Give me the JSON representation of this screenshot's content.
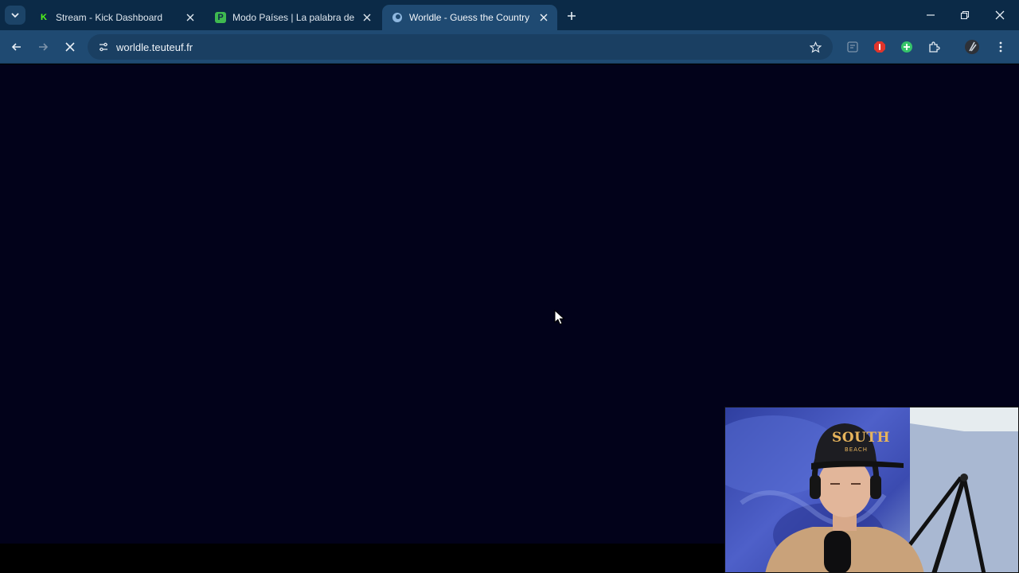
{
  "browser": {
    "tabs": [
      {
        "title": "Stream - Kick Dashboard",
        "favicon": "kick-logo-icon",
        "favicon_color": "#53fc18"
      },
      {
        "title": "Modo Países | La palabra del dí",
        "favicon": "p-logo-icon",
        "favicon_color": "#3fb950"
      },
      {
        "title": "Worldle - Guess the Country",
        "favicon": "worldle-globe-icon",
        "favicon_color": "#8fb8e0",
        "active": true
      }
    ],
    "address_bar": {
      "url": "worldle.teuteuf.fr"
    },
    "loading": true
  },
  "colors": {
    "tabstrip_bg": "#0b2a47",
    "toolbar_bg": "#1f4a72",
    "page_bg": "#02021a"
  },
  "overlay": {
    "webcam": {
      "cap_text": "SOUTH",
      "cap_subtext": "BEACH"
    }
  }
}
